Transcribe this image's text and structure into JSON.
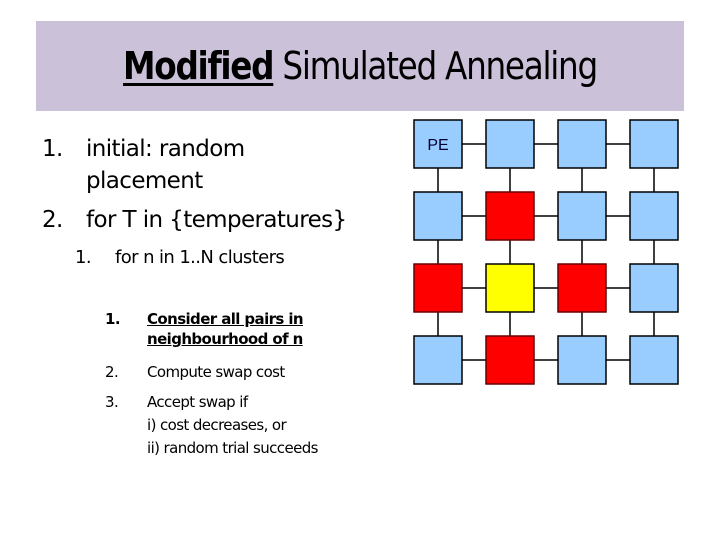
{
  "slide": {
    "title_emphasis": "Modified",
    "title_rest": " Simulated Annealing",
    "steps": [
      {
        "num": "1.",
        "lines": [
          "initial: random",
          "placement"
        ]
      },
      {
        "num": "2.",
        "lines": [
          "for T in {temperatures}"
        ]
      }
    ],
    "substep": {
      "num": "1.",
      "text": "for n in 1..N clusters"
    },
    "subsubsteps": [
      {
        "num": "1.",
        "lines": [
          "Consider all pairs in",
          "neighbourhood of n"
        ],
        "emphasis": true
      },
      {
        "num": "2.",
        "lines": [
          "Compute swap cost"
        ],
        "emphasis": false
      },
      {
        "num": "3.",
        "lines": [
          "Accept swap if",
          "i) cost decreases, or",
          "ii) random trial succeeds"
        ],
        "emphasis": false
      }
    ]
  },
  "grid": {
    "label": "PE",
    "rows": 4,
    "cols": 4,
    "colors": {
      "normal": "#99ccff",
      "neighbour": "#ff0000",
      "current": "#ffff00",
      "border": "#000000"
    },
    "cells": [
      [
        "normal",
        "normal",
        "normal",
        "normal"
      ],
      [
        "normal",
        "neighbour",
        "normal",
        "normal"
      ],
      [
        "neighbour",
        "current",
        "neighbour",
        "normal"
      ],
      [
        "normal",
        "neighbour",
        "normal",
        "normal"
      ]
    ]
  }
}
